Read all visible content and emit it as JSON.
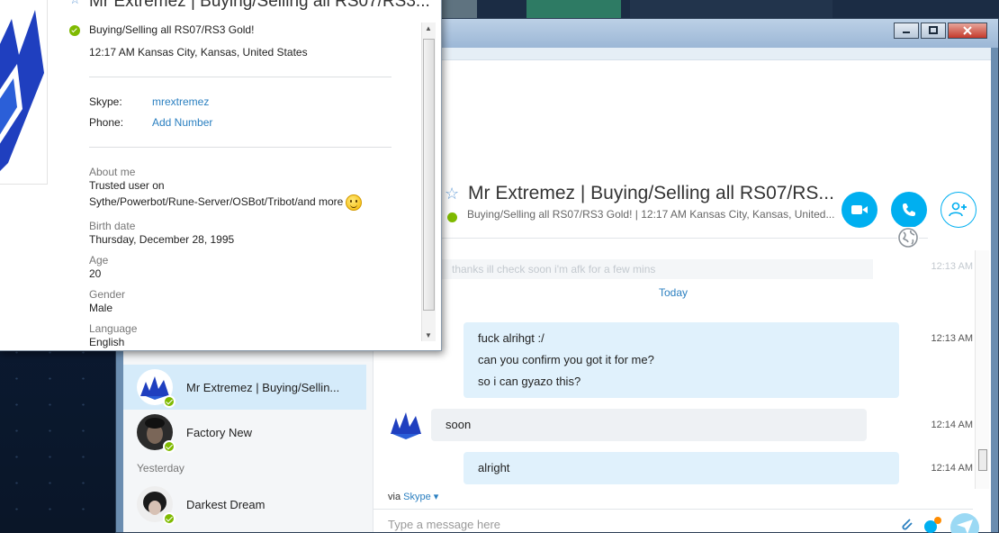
{
  "colors": {
    "accent": "#00aff0",
    "online": "#7fba00",
    "link": "#2a7fc0",
    "bubble_mine": "#e0f1fc",
    "bubble_theirs": "#eef1f4"
  },
  "window_controls": {
    "minimize": "minimize-icon",
    "maximize": "maximize-icon",
    "close": "close-icon"
  },
  "profile_popup": {
    "title": "Mr Extremez | Buying/Selling all RS07/RS3...",
    "mood": "Buying/Selling all RS07/RS3 Gold!",
    "location": "12:17 AM Kansas City, Kansas, United States",
    "skype_label": "Skype:",
    "skype_value": "mrextremez",
    "phone_label": "Phone:",
    "phone_value": "Add Number",
    "about_label": "About me",
    "about_line1": "Trusted user on",
    "about_line2": "Sythe/Powerbot/Rune-Server/OSBot/Tribot/and more",
    "birth_label": "Birth date",
    "birth_value": "Thursday, December 28, 1995",
    "age_label": "Age",
    "age_value": "20",
    "gender_label": "Gender",
    "gender_value": "Male",
    "language_label": "Language",
    "language_value": "English"
  },
  "recent": {
    "items": [
      {
        "name": "Mr Extremez | Buying/Sellin...",
        "active": true
      },
      {
        "name": "Factory New",
        "active": false
      }
    ],
    "yesterday_label": "Yesterday",
    "yesterday_items": [
      {
        "name": "Darkest Dream"
      }
    ]
  },
  "chat": {
    "title": "Mr Extremez | Buying/Selling all RS07/RS...",
    "subtitle": "Buying/Selling all RS07/RS3 Gold!  |  12:17 AM Kansas City, Kansas, United...",
    "buttons": {
      "video": "video-call-icon",
      "call": "phone-icon",
      "add": "add-contact-icon"
    },
    "faded_message": "thanks ill check soon i'm afk for a few mins",
    "faded_time": "12:13 AM",
    "today_label": "Today",
    "messages": [
      {
        "from": "me",
        "lines": [
          "fuck alrihgt :/",
          "can you confirm you got it for me?",
          "so i can gyazo this?"
        ],
        "time": "12:13 AM"
      },
      {
        "from": "them",
        "lines": [
          "soon"
        ],
        "time": "12:14 AM"
      },
      {
        "from": "me",
        "lines": [
          "alright"
        ],
        "time": "12:14 AM"
      }
    ],
    "via_label": "via",
    "via_link": "Skype",
    "compose_placeholder": "Type a message here"
  }
}
